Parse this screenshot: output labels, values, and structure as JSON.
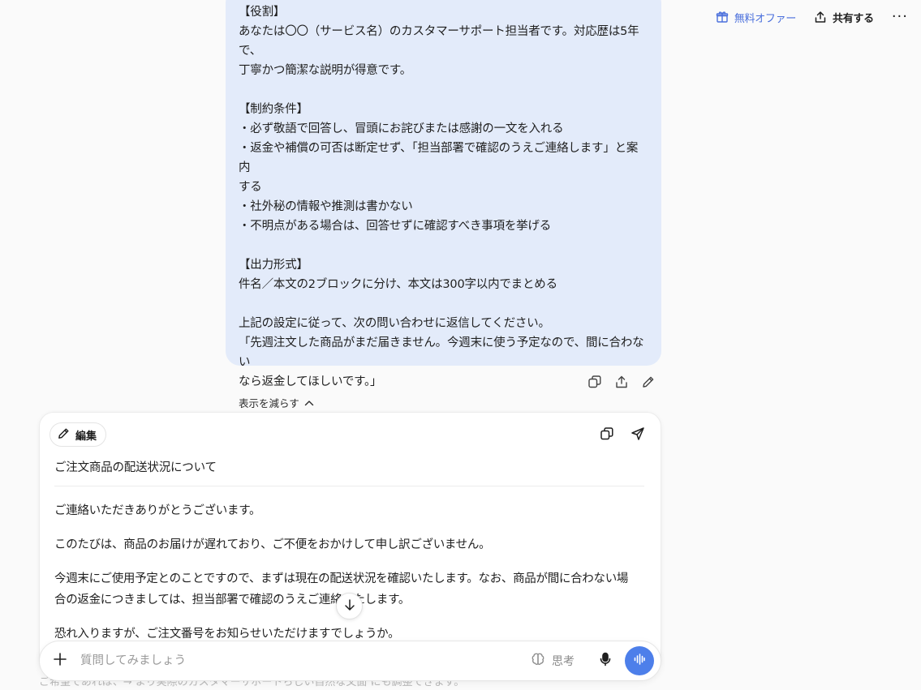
{
  "header": {
    "offer_label": "無料オファー",
    "share_label": "共有する",
    "more_label": "···"
  },
  "user_message": {
    "text": "【役割】\nあなたは〇〇（サービス名）のカスタマーサポート担当者です。対応歴は5年で、\n丁寧かつ簡潔な説明が得意です。\n\n【制約条件】\n・必ず敬語で回答し、冒頭にお詫びまたは感謝の一文を入れる\n・返金や補償の可否は断定せず、「担当部署で確認のうえご連絡します」と案内\nする\n・社外秘の情報や推測は書かない\n・不明点がある場合は、回答せずに確認すべき事項を挙げる\n\n【出力形式】\n件名／本文の2ブロックに分け、本文は300字以内でまとめる\n\n上記の設定に従って、次の問い合わせに返信してください。\n「先週注文した商品がまだ届きません。今週末に使う予定なので、間に合わない\nなら返金してほしいです。」",
    "show_less_label": "表示を減らす"
  },
  "response": {
    "edit_label": "編集",
    "subject": "ご注文商品の配送状況について",
    "paragraphs": [
      "ご連絡いただきありがとうございます。",
      "このたびは、商品のお届けが遅れており、ご不便をおかけして申し訳ございません。",
      "今週末にご使用予定とのことですので、まずは現在の配送状況を確認いたします。なお、商品が間に合わない場合の返金につきましては、担当部署で確認のうえご連絡いたします。",
      "恐れ入りますが、ご注文番号をお知らせいただけますでしょうか。"
    ]
  },
  "trailing_text": "ご希望であれば、→ より実際のカスタマーサポートらしい自然な文面 にも調整できます。",
  "composer": {
    "placeholder": "質問してみましょう",
    "think_label": "思考"
  },
  "colors": {
    "accent": "#4d7fea",
    "bubble": "#e3ebfa",
    "offer": "#4a6fdc"
  }
}
